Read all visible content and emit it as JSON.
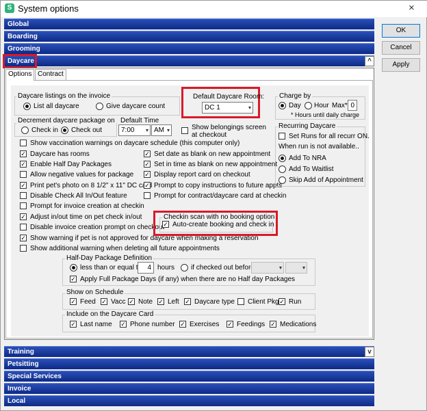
{
  "window": {
    "title": "System options",
    "close": "×"
  },
  "buttons": {
    "ok": "OK",
    "cancel": "Cancel",
    "apply": "Apply"
  },
  "sections": {
    "global": "Global",
    "boarding": "Boarding",
    "grooming": "Grooming",
    "daycare": "Daycare",
    "training": "Training",
    "petsitting": "Petsitting",
    "special": "Special Services",
    "invoice": "Invoice",
    "local": "Local"
  },
  "tabs": {
    "options": "Options",
    "contract": "Contract"
  },
  "listings": {
    "label": "Daycare listings on the invoice",
    "list_all": "List all daycare",
    "give_count": "Give daycare count"
  },
  "default_room": {
    "label": "Default Daycare Room:",
    "value": "DC 1"
  },
  "charge_by": {
    "label": "Charge by",
    "day": "Day",
    "hour": "Hour",
    "max_label": "Max*",
    "max_value": "0",
    "note": "* Hours until daily charge"
  },
  "decrement": {
    "label": "Decrement daycare package on",
    "check_in": "Check in",
    "check_out": "Check out"
  },
  "default_time": {
    "label": "Default Time",
    "time": "7:00",
    "ampm": "AM"
  },
  "show_belongings": "Show belongings screen at checkout",
  "left_options": [
    {
      "label": "Show vaccination warnings on daycare schedule (this computer only)",
      "checked": false
    },
    {
      "label": "Daycare has rooms",
      "checked": true
    },
    {
      "label": "Enable Half Day Packages",
      "checked": true
    },
    {
      "label": "Allow negative values for package",
      "checked": false
    },
    {
      "label": "Print pet's photo on 8 1/2\" x 11\" DC card",
      "checked": true
    },
    {
      "label": "Disable Check All In/Out feature",
      "checked": false
    },
    {
      "label": "Prompt for invoice creation at checkin",
      "checked": false
    },
    {
      "label": "Adjust in/out time on pet check in/out",
      "checked": true
    },
    {
      "label": "Disable invoice creation prompt on checkout",
      "checked": false
    },
    {
      "label": "Show warning if pet is not approved for daycare when making a reservation",
      "checked": true
    },
    {
      "label": "Show additional warning when deleting all future appointments",
      "checked": false
    }
  ],
  "mid_options": [
    {
      "label": "Set date as blank on new appointment",
      "checked": true
    },
    {
      "label": "Set in time as blank on new appointment",
      "checked": true
    },
    {
      "label": "Display report card on checkout",
      "checked": true
    },
    {
      "label": "Prompt to copy instructions to future appts",
      "checked": true
    },
    {
      "label": "Prompt for contract/daycare card at checkin",
      "checked": false
    }
  ],
  "recurring": {
    "label": "Recurring Daycare",
    "set_runs": "Set Runs for all recurr ON.",
    "when_not_available": "When run is not available..",
    "add_nra": "Add To NRA",
    "add_waitlist": "Add To Waitlist",
    "skip": "Skip Add of Appointment"
  },
  "checkin_scan": {
    "label": "Checkin scan with no booking option",
    "auto_create": "Auto-create booking and check in"
  },
  "half_day": {
    "label": "Half-Day Package Definition",
    "lte": "less than or equal to",
    "hours_value": "4",
    "hours": "hours",
    "if_checked_out": "if checked out before",
    "apply_full": "Apply Full Package Days (if any) when there are no Half day Packages"
  },
  "show_on_schedule": {
    "label": "Show on Schedule",
    "items": [
      {
        "label": "Feed",
        "checked": true
      },
      {
        "label": "Vacc",
        "checked": true
      },
      {
        "label": "Note",
        "checked": true
      },
      {
        "label": "Left",
        "checked": true
      },
      {
        "label": "Daycare type",
        "checked": true
      },
      {
        "label": "Client Pkg",
        "checked": false
      },
      {
        "label": "Run",
        "checked": true
      }
    ]
  },
  "daycare_card": {
    "label": "Include on the Daycare Card",
    "items": [
      {
        "label": "Last name",
        "checked": true
      },
      {
        "label": "Phone number",
        "checked": true
      },
      {
        "label": "Exercises",
        "checked": true
      },
      {
        "label": "Feedings",
        "checked": true
      },
      {
        "label": "Medications",
        "checked": true
      }
    ]
  },
  "icons": {
    "app": "app-icon",
    "arrow": "▾",
    "check": "✓",
    "scroll_up": "^",
    "scroll_down": "v"
  },
  "colors": {
    "section_bar": "#1a3a9c",
    "highlight": "#d71a2a"
  }
}
